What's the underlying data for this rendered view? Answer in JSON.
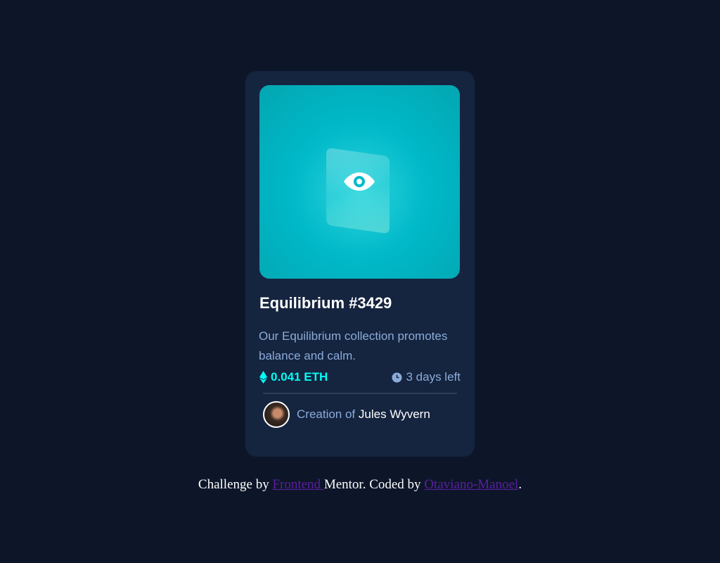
{
  "card": {
    "title": "Equilibrium #3429",
    "description": "Our Equilibrium collection promotes balance and calm.",
    "price": "0.041 ETH",
    "time_left": "3 days left",
    "creator_prefix": "Creation of",
    "creator_name": "Jules Wyvern"
  },
  "footer": {
    "text1": "Challenge by ",
    "link1": "Frontend ",
    "text2": "Mentor. Coded by ",
    "link2": "Otaviano-Manoel",
    "text3": "."
  },
  "colors": {
    "background": "#0d1629",
    "card": "#15243f",
    "accent": "#00fff8",
    "muted": "#8bacd9"
  }
}
